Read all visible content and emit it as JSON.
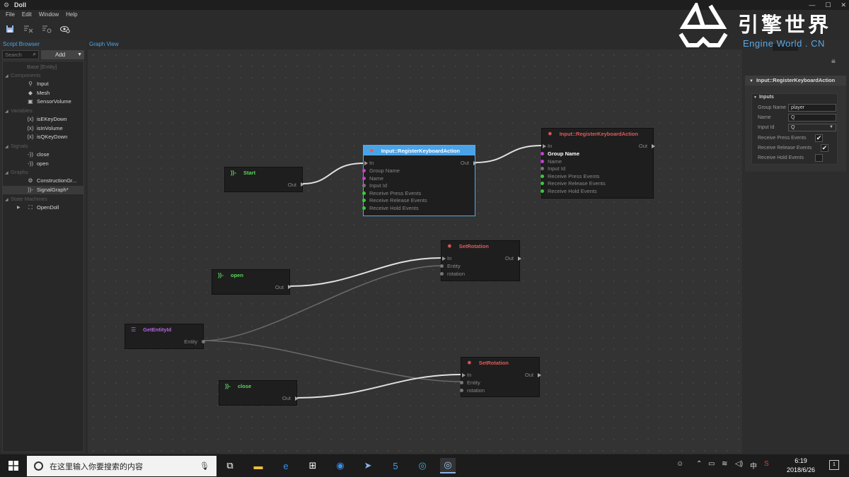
{
  "window": {
    "title": "Doll",
    "controls": [
      "—",
      "☐",
      "✕"
    ]
  },
  "menu": [
    "File",
    "Edit",
    "Window",
    "Help"
  ],
  "left_panel": {
    "title": "Script Browser",
    "search_placeholder": "Search",
    "add_label": "Add",
    "tree": {
      "base": "Base [Entity]",
      "components_label": "Components",
      "components": [
        "Input",
        "Mesh",
        "SensorVolume"
      ],
      "variables_label": "Variables",
      "variables": [
        "isEKeyDown",
        "isInVolume",
        "isQKeyDown"
      ],
      "signals_label": "Signals",
      "signals": [
        "close",
        "open"
      ],
      "graphs_label": "Graphs",
      "graphs": [
        "ConstructionGr...",
        "SignalGraph*"
      ],
      "state_machines_label": "State Machines",
      "state_machines": [
        "OpenDoll"
      ]
    }
  },
  "graph": {
    "title": "Graph View",
    "nodes": {
      "start": {
        "title": "Start",
        "out": "Out"
      },
      "reg1": {
        "title": "Input::RegisterKeyboardAction",
        "in": "In",
        "out": "Out",
        "pins": [
          "Group Name",
          "Name",
          "Input Id",
          "Receive Press Events",
          "Receive Release Events",
          "Receive Hold Events"
        ]
      },
      "reg2": {
        "title": "Input::RegisterKeyboardAction",
        "in": "In",
        "out": "Out",
        "pins": [
          "Group Name",
          "Name",
          "Input Id",
          "Receive Press Events",
          "Receive Release Events",
          "Receive Hold Events"
        ]
      },
      "open": {
        "title": "open",
        "out": "Out"
      },
      "setrot1": {
        "title": "SetRotation",
        "in": "In",
        "out": "Out",
        "pins": [
          "Entity",
          "rotation"
        ]
      },
      "getentity": {
        "title": "GetEntityId",
        "out": "Entity"
      },
      "close": {
        "title": "close",
        "out": "Out"
      },
      "setrot2": {
        "title": "SetRotation",
        "in": "In",
        "out": "Out",
        "pins": [
          "Entity",
          "rotation"
        ]
      }
    }
  },
  "properties": {
    "header": "Input::RegisterKeyboardAction",
    "group": "Inputs",
    "fields": [
      {
        "label": "Group Name",
        "value": "player"
      },
      {
        "label": "Name",
        "value": "Q"
      },
      {
        "label": "Input Id",
        "value": "Q"
      }
    ],
    "checks": [
      {
        "label": "Receive Press Events",
        "checked": true
      },
      {
        "label": "Receive Release Events",
        "checked": true
      },
      {
        "label": "Receive Hold Events",
        "checked": false
      }
    ]
  },
  "watermark": {
    "title": "引擎世界",
    "subtitle": "Engine World . CN"
  },
  "taskbar": {
    "search_placeholder": "在这里输入你要搜索的内容",
    "ime": "中",
    "time": "6:19",
    "date": "2018/6/26",
    "notification_count": "1"
  },
  "colors": {
    "accent": "#4aa3e8",
    "exec_pin": "#3cc83c",
    "data_pin": "#c83cd7",
    "function_header": "#e05a5a",
    "event_header": "#5ad65a",
    "getter_header": "#b466e0"
  }
}
